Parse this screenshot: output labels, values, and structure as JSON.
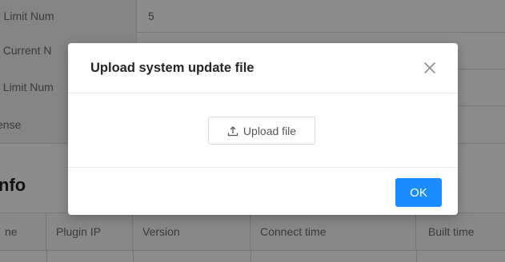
{
  "background": {
    "info_rows": [
      {
        "label": "r Limit Num",
        "value": "5"
      },
      {
        "label": "t Current N",
        "value": ""
      },
      {
        "label": "t Limit Num",
        "value": ""
      },
      {
        "label": "ense",
        "value": ""
      }
    ],
    "section_title": "nfo",
    "table_headers": [
      "ne",
      "Plugin IP",
      "Version",
      "Connect time",
      "Built time"
    ]
  },
  "modal": {
    "title": "Upload system update file",
    "close_icon": "close-icon",
    "upload_button_label": "Upload file",
    "upload_icon": "upload-icon",
    "ok_label": "OK",
    "accent_color": "#1a8cff"
  }
}
